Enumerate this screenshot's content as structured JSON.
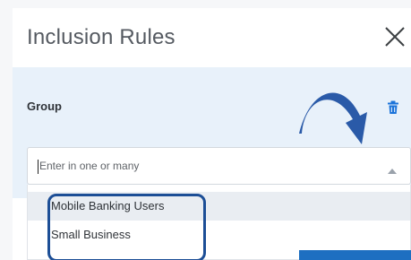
{
  "dialog": {
    "title": "Inclusion Rules"
  },
  "group": {
    "label": "Group",
    "input_placeholder": "Enter in one or many",
    "options": [
      {
        "label": "Mobile Banking Users"
      },
      {
        "label": "Small Business"
      }
    ]
  },
  "icons": {
    "close": "close-icon",
    "delete": "trash-icon",
    "toggle": "chevron-up-icon",
    "annotation_arrow": "curved-arrow-icon"
  },
  "colors": {
    "panel_bg": "#e8f1fa",
    "accent_blue": "#1e6fc1",
    "trash_blue": "#1a73d9",
    "annotation_navy": "#1c4e96"
  }
}
